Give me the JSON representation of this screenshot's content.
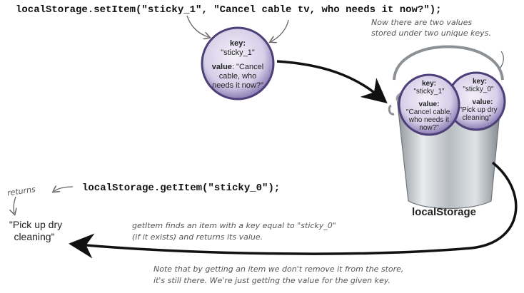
{
  "code": {
    "set_item": "localStorage.setItem(\"sticky_1\", \"Cancel cable tv, who needs it now?\");",
    "get_item": "localStorage.getItem(\"sticky_0\");"
  },
  "sticky_top": {
    "key_label": "key:",
    "key_value": "\"sticky_1\"",
    "value_label": "value",
    "value_line1": ": \"Cancel",
    "value_line2": "cable, who",
    "value_line3": "needs it now?\""
  },
  "bucket_sticky_1": {
    "key_label": "key:",
    "key_value": "\"sticky_1\"",
    "value_label": "value:",
    "value_line1": "\"Cancel cable,",
    "value_line2": "who needs it",
    "value_line3": "now?\""
  },
  "bucket_sticky_0": {
    "key_label": "key:",
    "key_value": "\"sticky_0\"",
    "value_label": "value:",
    "value_line1": "\"Pick up dry",
    "value_line2": "cleaning\""
  },
  "notes": {
    "two_values_line1": "Now there are two values",
    "two_values_line2": "stored under two unique keys.",
    "returns": "returns",
    "getitem_line1": "getItem finds an item with a key equal to \"sticky_0\"",
    "getitem_line2": "(if it exists) and returns its value.",
    "note_line1": "Note that by getting an item we don't remove it from the store,",
    "note_line2": "it's still there. We're just getting the value for the given key."
  },
  "result": {
    "line1": "\"Pick up dry",
    "line2": "cleaning\""
  },
  "storage_label": "localStorage",
  "colors": {
    "sticky_fill": "#d8d2ea",
    "sticky_border": "#5a4a86",
    "bucket": "#b9bec3",
    "arrow": "#111111"
  }
}
